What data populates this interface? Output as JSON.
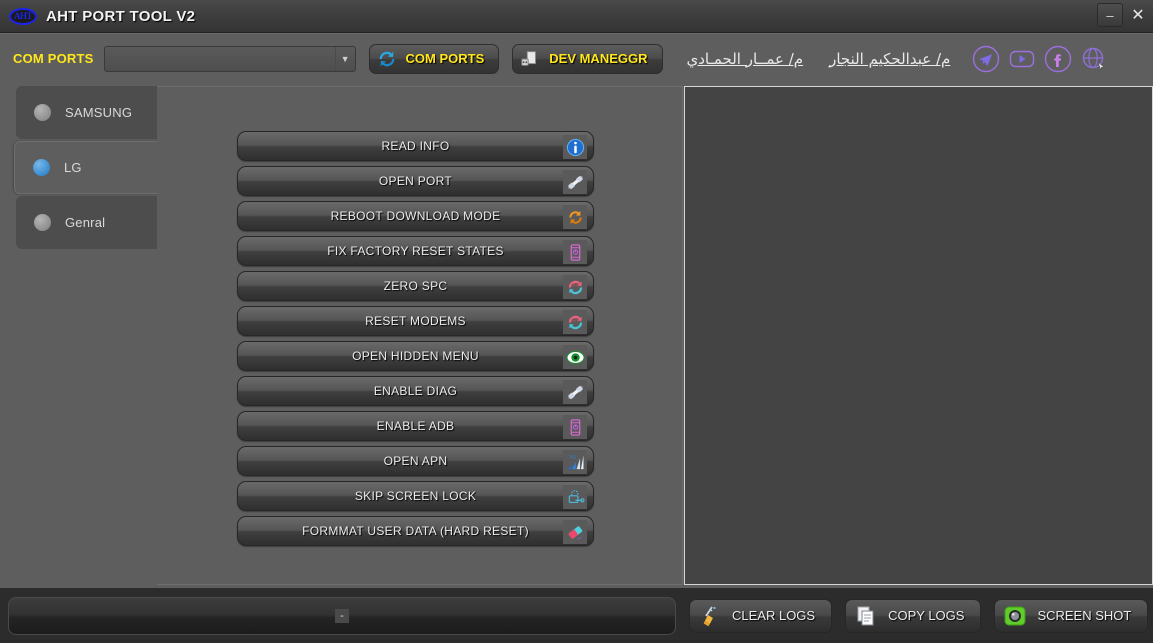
{
  "window": {
    "title": "AHT PORT TOOL V2",
    "logo_text": "AHT",
    "minimize_label": "–",
    "close_label": "✕"
  },
  "toolbar": {
    "com_ports_label": "COM PORTS",
    "com_ports_value": "",
    "com_ports_placeholder": "",
    "buttons": [
      {
        "label": "COM PORTS",
        "icon": "refresh-icon"
      },
      {
        "label": "DEV MANEGGR",
        "icon": "device-manager-icon"
      }
    ],
    "links": [
      {
        "label": "م/ عبدالحكيم النجار"
      },
      {
        "label": "م/ عمــار الحمـادي"
      }
    ],
    "social": [
      {
        "name": "telegram-icon"
      },
      {
        "name": "youtube-icon"
      },
      {
        "name": "facebook-icon"
      },
      {
        "name": "website-icon"
      }
    ]
  },
  "sidebar": {
    "tabs": [
      {
        "label": "SAMSUNG",
        "selected": false
      },
      {
        "label": "LG",
        "selected": true
      },
      {
        "label": "Genral",
        "selected": false
      }
    ]
  },
  "main": {
    "buttons": [
      {
        "label": "READ INFO",
        "icon": "info-icon"
      },
      {
        "label": "OPEN PORT",
        "icon": "plug-icon"
      },
      {
        "label": "REBOOT DOWNLOAD MODE",
        "icon": "reboot-icon"
      },
      {
        "label": "FIX FACTORY RESET STATES",
        "icon": "phone-reset-icon"
      },
      {
        "label": "ZERO  SPC",
        "icon": "spc-icon"
      },
      {
        "label": "RESET MODEMS",
        "icon": "spc-icon"
      },
      {
        "label": "OPEN HIDDEN MENU",
        "icon": "eye-icon"
      },
      {
        "label": "ENABLE  DIAG",
        "icon": "plug-icon"
      },
      {
        "label": "ENABLE ADB",
        "icon": "phone-reset-icon"
      },
      {
        "label": "OPEN  APN",
        "icon": "signal-3g-icon"
      },
      {
        "label": "SKIP SCREEN LOCK",
        "icon": "lock-key-icon"
      },
      {
        "label": "FORMMAT USER  DATA  (HARD RESET)",
        "icon": "eraser-icon"
      }
    ]
  },
  "log_panel": {
    "content": ""
  },
  "bottom": {
    "status_text": "-",
    "buttons": [
      {
        "label": "CLEAR LOGS",
        "icon": "broom-icon"
      },
      {
        "label": "COPY LOGS",
        "icon": "copy-icon"
      },
      {
        "label": "SCREEN SHOT",
        "icon": "camera-icon"
      }
    ]
  },
  "colors": {
    "accent_yellow": "#ffe71a",
    "selected_dot_blue": "#3b8fd4",
    "window_bg": "#5e5e5e",
    "title_bg": "#3d3d3d",
    "log_bg": "#444444"
  }
}
